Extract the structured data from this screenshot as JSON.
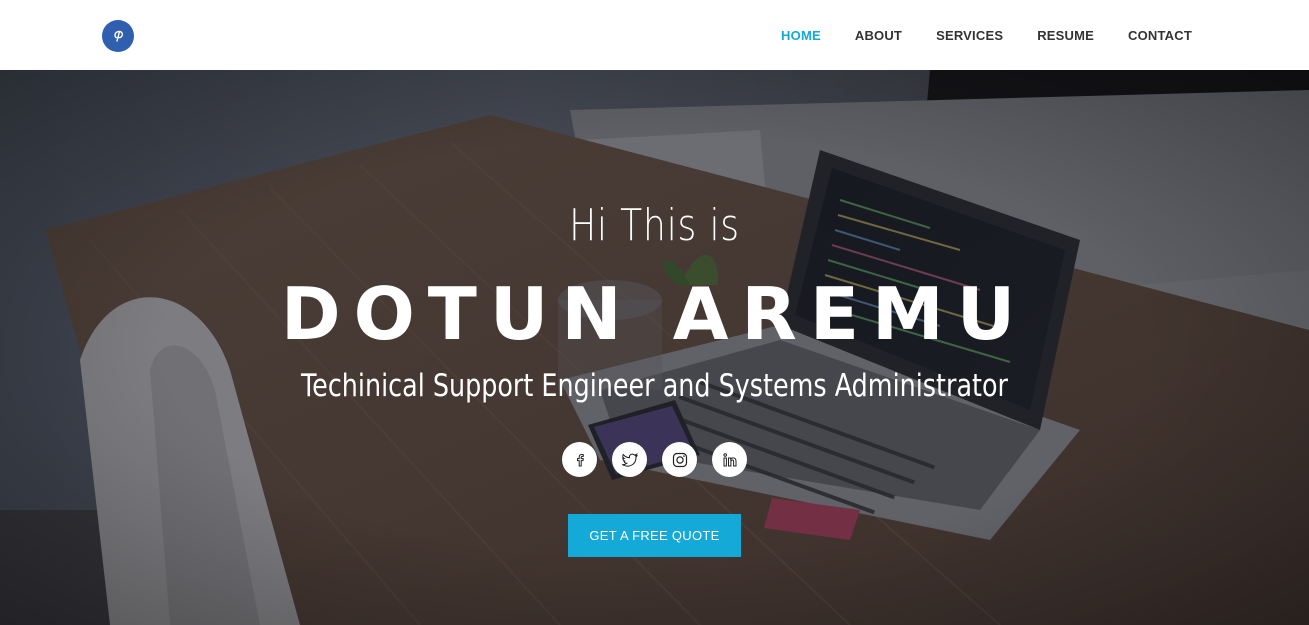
{
  "brand": {
    "logo_icon": "pinterest-p-logo-icon",
    "color": "#2f5fae"
  },
  "nav": {
    "items": [
      {
        "label": "HOME",
        "active": true
      },
      {
        "label": "ABOUT",
        "active": false
      },
      {
        "label": "SERVICES",
        "active": false
      },
      {
        "label": "RESUME",
        "active": false
      },
      {
        "label": "CONTACT",
        "active": false
      }
    ],
    "active_color": "#14a9d6"
  },
  "hero": {
    "greeting": "Hi This is",
    "name": "DOTUN AREMU",
    "tagline": "Techinical Support Engineer and Systems Administrator",
    "socials": [
      {
        "icon": "facebook-icon"
      },
      {
        "icon": "twitter-icon"
      },
      {
        "icon": "instagram-icon"
      },
      {
        "icon": "linkedin-icon"
      }
    ],
    "cta_label": "GET A FREE QUOTE",
    "cta_color": "#14a9d6"
  }
}
